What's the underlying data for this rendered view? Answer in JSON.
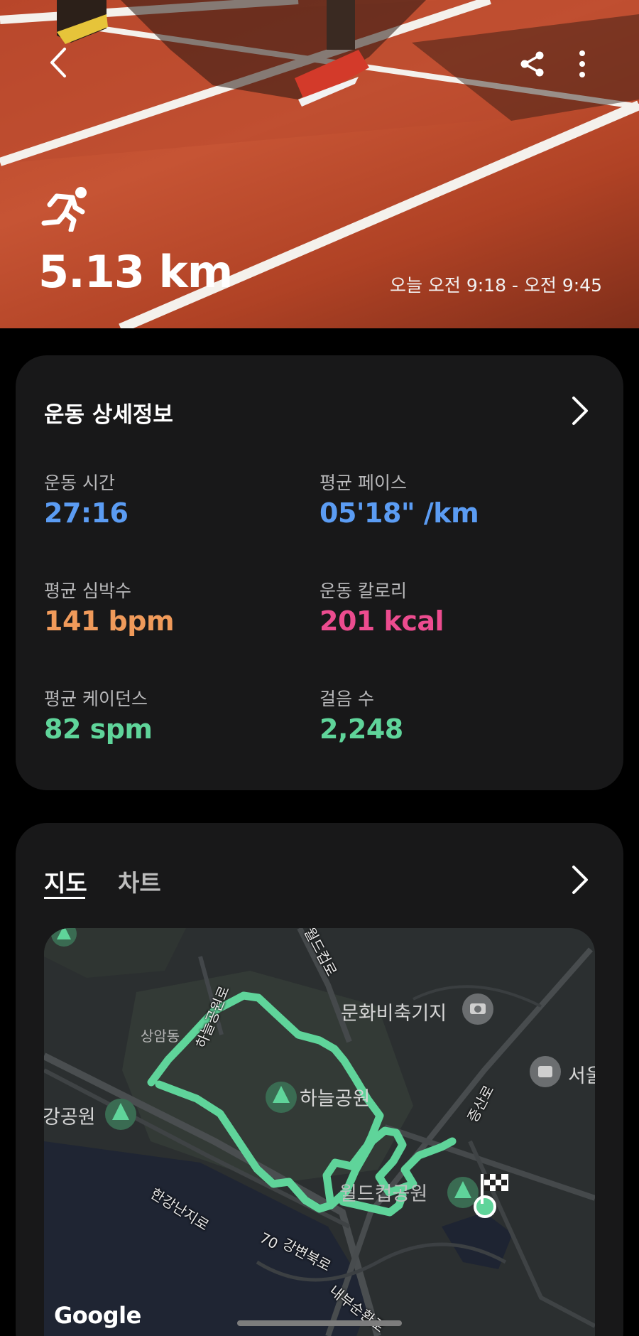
{
  "header": {
    "back_icon": "chevron-left-icon",
    "share_icon": "share-icon",
    "more_icon": "more-vertical-icon",
    "activity_icon": "running-icon",
    "distance": "5.13 km",
    "time_range": "오늘 오전 9:18 - 오전 9:45"
  },
  "details": {
    "title": "운동 상세정보",
    "stats": [
      {
        "label": "운동 시간",
        "value": "27:16",
        "color": "#5b9cf3"
      },
      {
        "label": "평균 페이스",
        "value": "05'18\" /km",
        "color": "#5b9cf3"
      },
      {
        "label": "평균 심박수",
        "value": "141 bpm",
        "color": "#f09a5a"
      },
      {
        "label": "운동 칼로리",
        "value": "201 kcal",
        "color": "#ec4c8f"
      },
      {
        "label": "평균 케이던스",
        "value": "82 spm",
        "color": "#5fd49a"
      },
      {
        "label": "걸음 수",
        "value": "2,248",
        "color": "#5fd49a"
      }
    ]
  },
  "map_card": {
    "tabs": [
      {
        "label": "지도",
        "selected": true
      },
      {
        "label": "차트",
        "selected": false
      }
    ],
    "map": {
      "places": [
        "문화비축기지",
        "하늘공원",
        "상암동",
        "강공원",
        "월드컵공원",
        "서울"
      ],
      "roads": [
        "월드컵로",
        "하늘공원로",
        "증산로",
        "한강난지로",
        "70",
        "강변북로",
        "내부순환로"
      ],
      "route_color": "#5fd49a",
      "attribution": "Google"
    }
  }
}
